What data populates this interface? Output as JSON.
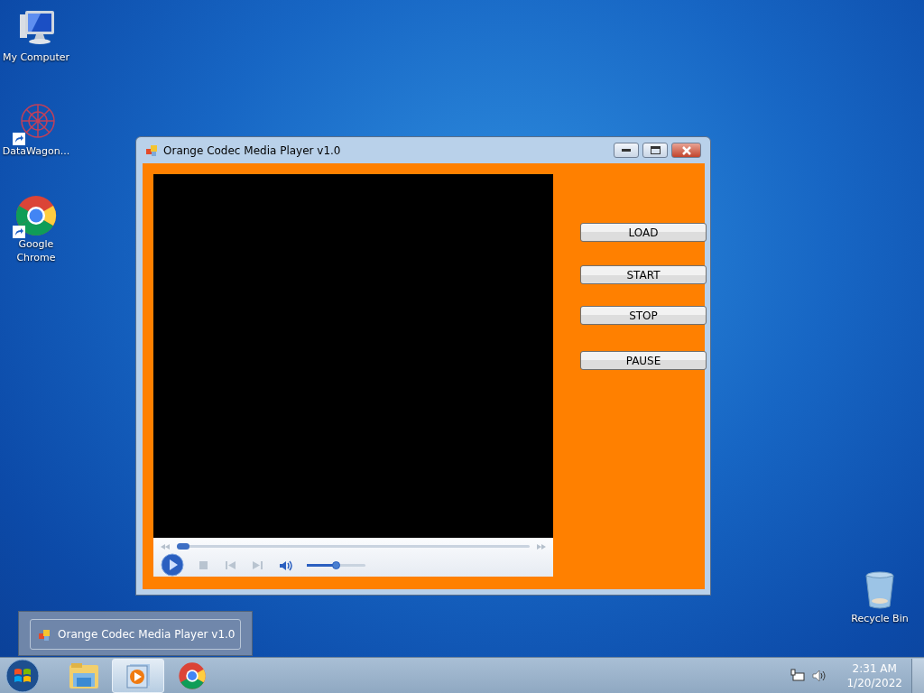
{
  "desktop_icons": [
    {
      "kind": "computer",
      "label": "My Computer",
      "shortcut": false
    },
    {
      "kind": "network",
      "label": "DataWagon...",
      "shortcut": true
    },
    {
      "kind": "chrome",
      "label": "Google Chrome",
      "shortcut": true
    },
    {
      "kind": "recycle",
      "label": "Recycle Bin",
      "shortcut": false
    }
  ],
  "window": {
    "title": "Orange Codec Media Player v1.0",
    "buttons": [
      "LOAD",
      "START",
      "STOP",
      "PAUSE"
    ],
    "player": {
      "seek": {
        "level": 0.02
      },
      "volume": {
        "level": 0.5
      }
    }
  },
  "thumbnail_preview": {
    "title": "Orange Codec Media Player v1.0"
  },
  "taskbar": {
    "items": [
      {
        "kind": "explorer",
        "selected": false
      },
      {
        "kind": "mediaplayer",
        "selected": true
      },
      {
        "kind": "chrome",
        "selected": false
      }
    ],
    "clock": {
      "time": "2:31 AM",
      "date": "1/20/2022"
    }
  }
}
